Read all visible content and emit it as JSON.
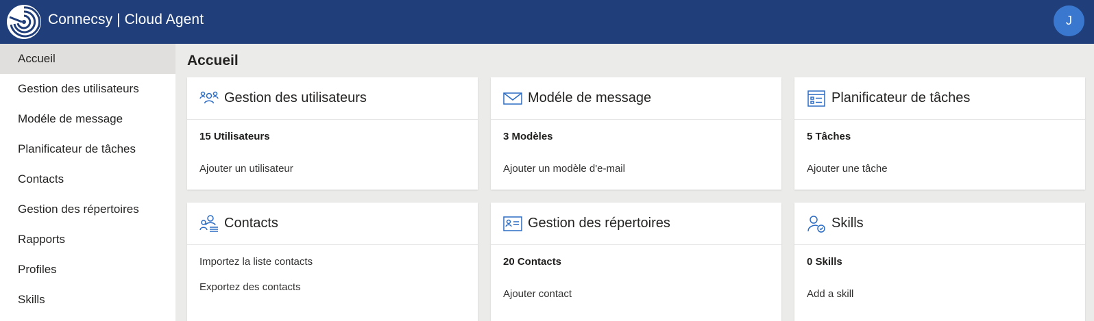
{
  "header": {
    "title": "Connecsy | Cloud Agent",
    "avatar_initial": "J"
  },
  "sidebar": {
    "items": [
      {
        "label": "Accueil",
        "active": true
      },
      {
        "label": "Gestion des utilisateurs"
      },
      {
        "label": "Modéle de message"
      },
      {
        "label": "Planificateur de tâches"
      },
      {
        "label": "Contacts"
      },
      {
        "label": "Gestion des répertoires"
      },
      {
        "label": "Rapports"
      },
      {
        "label": "Profiles"
      },
      {
        "label": "Skills"
      }
    ]
  },
  "main": {
    "title": "Accueil",
    "cards": [
      {
        "title": "Gestion des utilisateurs",
        "icon": "users-icon",
        "count": "15 Utilisateurs",
        "links": [
          "Ajouter un utilisateur"
        ]
      },
      {
        "title": "Modéle de message",
        "icon": "mail-icon",
        "count": "3 Modèles",
        "links": [
          "Ajouter un modèle d'e-mail"
        ]
      },
      {
        "title": "Planificateur de tâches",
        "icon": "task-list-icon",
        "count": "5 Tâches",
        "links": [
          "Ajouter une tâche"
        ]
      },
      {
        "title": "Contacts",
        "icon": "contacts-icon",
        "links": [
          "Importez la liste contacts",
          "Exportez des contacts"
        ]
      },
      {
        "title": "Gestion des répertoires",
        "icon": "contact-card-icon",
        "count": "20 Contacts",
        "links": [
          "Ajouter contact"
        ]
      },
      {
        "title": "Skills",
        "icon": "skills-icon",
        "count": "0 Skills",
        "links": [
          "Add a skill"
        ]
      }
    ]
  },
  "colors": {
    "header_bg": "#1f3e7a",
    "accent": "#2b6cc4",
    "avatar_bg": "#3a78cf",
    "page_bg": "#ebebea"
  }
}
